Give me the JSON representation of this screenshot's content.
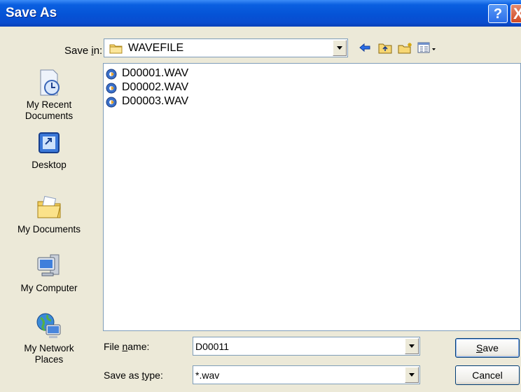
{
  "window": {
    "title": "Save As",
    "help_glyph": "?",
    "close_glyph": "X"
  },
  "save_in": {
    "label": "Save in:",
    "value": "WAVEFILE",
    "icon": "folder-icon"
  },
  "toolbar": {
    "back_icon": "back-arrow-icon",
    "up_icon": "up-one-level-icon",
    "new_folder_icon": "new-folder-icon",
    "views_icon": "views-menu-icon"
  },
  "places": [
    {
      "label": "My Recent Documents",
      "icon": "recent-documents-icon"
    },
    {
      "label": "Desktop",
      "icon": "desktop-icon"
    },
    {
      "label": "My Documents",
      "icon": "my-documents-icon"
    },
    {
      "label": "My Computer",
      "icon": "my-computer-icon"
    },
    {
      "label": "My Network Places",
      "icon": "network-places-icon"
    }
  ],
  "files": [
    {
      "name": "D00001.WAV",
      "icon": "audio-file-icon"
    },
    {
      "name": "D00002.WAV",
      "icon": "audio-file-icon"
    },
    {
      "name": "D00003.WAV",
      "icon": "audio-file-icon"
    }
  ],
  "file_name": {
    "label": "File name:",
    "value": "D00011"
  },
  "save_as_type": {
    "label": "Save as type:",
    "value": "*.wav"
  },
  "buttons": {
    "save": "Save",
    "cancel": "Cancel"
  },
  "colors": {
    "titlebar": "#0553d6",
    "dialog_bg": "#ece9d8",
    "field_border": "#7f9db9"
  }
}
